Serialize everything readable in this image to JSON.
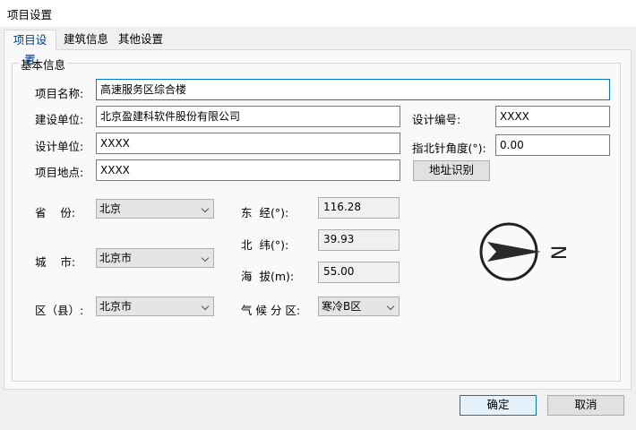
{
  "window": {
    "title": "项目设置"
  },
  "tabs": [
    {
      "label": "项目设置",
      "active": true
    },
    {
      "label": "建筑信息",
      "active": false
    },
    {
      "label": "其他设置",
      "active": false
    }
  ],
  "basic_info": {
    "group_label": "基本信息",
    "project_name": {
      "label": "项目名称:",
      "value": "高速服务区综合楼"
    },
    "construction_unit": {
      "label": "建设单位:",
      "value": "北京盈建科软件股份有限公司"
    },
    "design_unit": {
      "label": "设计单位:",
      "value": "XXXX"
    },
    "project_location": {
      "label": "项目地点:",
      "value": "XXXX"
    },
    "design_number": {
      "label": "设计编号:",
      "value": "XXXX"
    },
    "north_angle": {
      "label": "指北针角度(°):",
      "value": "0.00"
    },
    "address_button": "地址识别"
  },
  "location": {
    "province": {
      "label": "省    份:",
      "value": "北京"
    },
    "city": {
      "label": "城    市:",
      "value": "北京市"
    },
    "district": {
      "label": "区（县）:",
      "value": "北京市"
    },
    "longitude": {
      "label": "东  经(°):",
      "value": "116.28"
    },
    "latitude": {
      "label": "北  纬(°):",
      "value": "39.93"
    },
    "altitude": {
      "label": "海  拔(m):",
      "value": "55.00"
    },
    "climate_zone": {
      "label": "气 候 分 区:",
      "value": "寒冷B区"
    }
  },
  "compass": {
    "letter": "N",
    "angle_deg": 0
  },
  "footer": {
    "ok_label": "确定",
    "cancel_label": "取消"
  }
}
